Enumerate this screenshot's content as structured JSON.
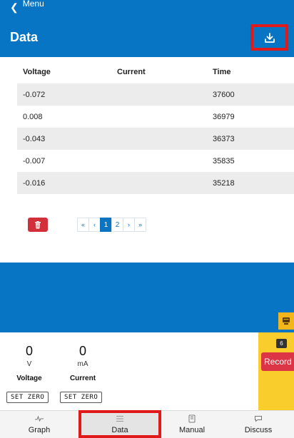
{
  "header": {
    "back_label": "Menu",
    "title": "Data",
    "download_icon": "download-icon"
  },
  "table": {
    "columns": [
      "Voltage",
      "Current",
      "Time"
    ],
    "rows": [
      [
        "-0.072",
        "",
        "37600"
      ],
      [
        "0.008",
        "",
        "36979"
      ],
      [
        "-0.043",
        "",
        "36373"
      ],
      [
        "-0.007",
        "",
        "35835"
      ],
      [
        "-0.016",
        "",
        "35218"
      ]
    ]
  },
  "pagination": {
    "first": "«",
    "prev": "‹",
    "pages": [
      "1",
      "2"
    ],
    "active_page": "1",
    "next": "›",
    "last": "»"
  },
  "readouts": [
    {
      "value": "0",
      "unit": "V",
      "label": "Voltage",
      "button": "SET ZERO"
    },
    {
      "value": "0",
      "unit": "mA",
      "label": "Current",
      "button": "SET ZERO"
    }
  ],
  "record": {
    "count": "6",
    "label": "Record"
  },
  "nav": {
    "tabs": [
      "Graph",
      "Data",
      "Manual",
      "Discuss"
    ],
    "active": "Data"
  },
  "colors": {
    "primary": "#0875c4",
    "danger": "#d32f3a",
    "accent_yellow": "#f8cd2c",
    "highlight": "#e01a1a"
  }
}
